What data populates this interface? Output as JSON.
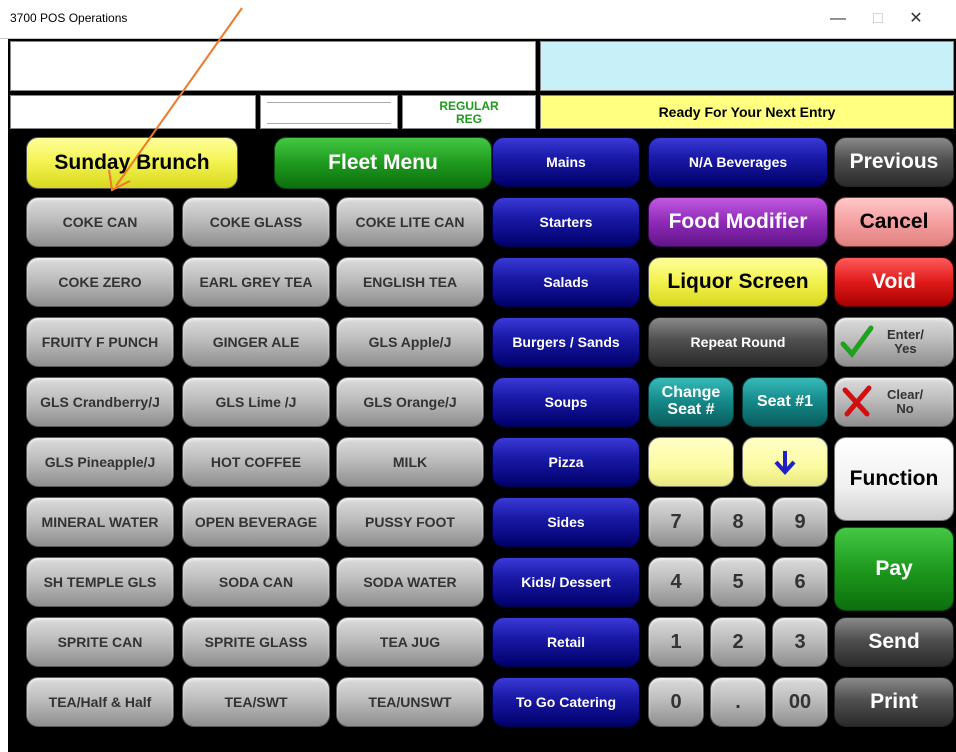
{
  "window": {
    "title": "3700 POS Operations",
    "minimize": "—",
    "maximize": "□",
    "close": "✕"
  },
  "header": {
    "order_mode_line1": "REGULAR",
    "order_mode_line2": "REG",
    "status_message": "Ready For Your Next Entry"
  },
  "top_buttons": {
    "sunday_brunch": "Sunday Brunch",
    "fleet_menu": "Fleet Menu"
  },
  "menu_items": [
    "COKE CAN",
    "COKE GLASS",
    "COKE LITE CAN",
    "COKE ZERO",
    "EARL GREY TEA",
    "ENGLISH TEA",
    "FRUITY F PUNCH",
    "GINGER ALE",
    "GLS  Apple/J",
    "GLS Crandberry/J",
    "GLS Lime /J",
    "GLS Orange/J",
    "GLS Pineapple/J",
    "HOT COFFEE",
    "MILK",
    "MINERAL WATER",
    "OPEN BEVERAGE",
    "PUSSY FOOT",
    "SH TEMPLE GLS",
    "SODA CAN",
    "SODA WATER",
    "SPRITE CAN",
    "SPRITE GLASS",
    "TEA JUG",
    "TEA/Half & Half",
    "TEA/SWT",
    "TEA/UNSWT"
  ],
  "categories": [
    "Mains",
    "Starters",
    "Salads",
    "Burgers / Sands",
    "Soups",
    "Pizza",
    "Sides",
    "Kids/ Dessert",
    "Retail",
    "To Go Catering"
  ],
  "functions": {
    "na_beverages": "N/A Beverages",
    "food_modifier": "Food Modifier",
    "liquor_screen": "Liquor Screen",
    "repeat_round": "Repeat Round",
    "change_seat_line1": "Change",
    "change_seat_line2": "Seat #",
    "seat_1": "Seat #1",
    "down_arrow": "↓"
  },
  "keypad": [
    "7",
    "8",
    "9",
    "4",
    "5",
    "6",
    "1",
    "2",
    "3",
    "0",
    ".",
    "00"
  ],
  "right_column": {
    "previous": "Previous",
    "cancel": "Cancel",
    "void": "Void",
    "enter_line1": "Enter/",
    "enter_line2": "Yes",
    "clear_line1": "Clear/",
    "clear_line2": "No",
    "function": "Function",
    "pay": "Pay",
    "send": "Send",
    "print": "Print"
  },
  "colors": {
    "annotation_arrow": "#f07828",
    "status_bar": "#ffff80",
    "display_top_right": "#c8f0f8"
  },
  "icons": {
    "enter": "checkmark-icon",
    "clear": "x-mark-icon"
  }
}
